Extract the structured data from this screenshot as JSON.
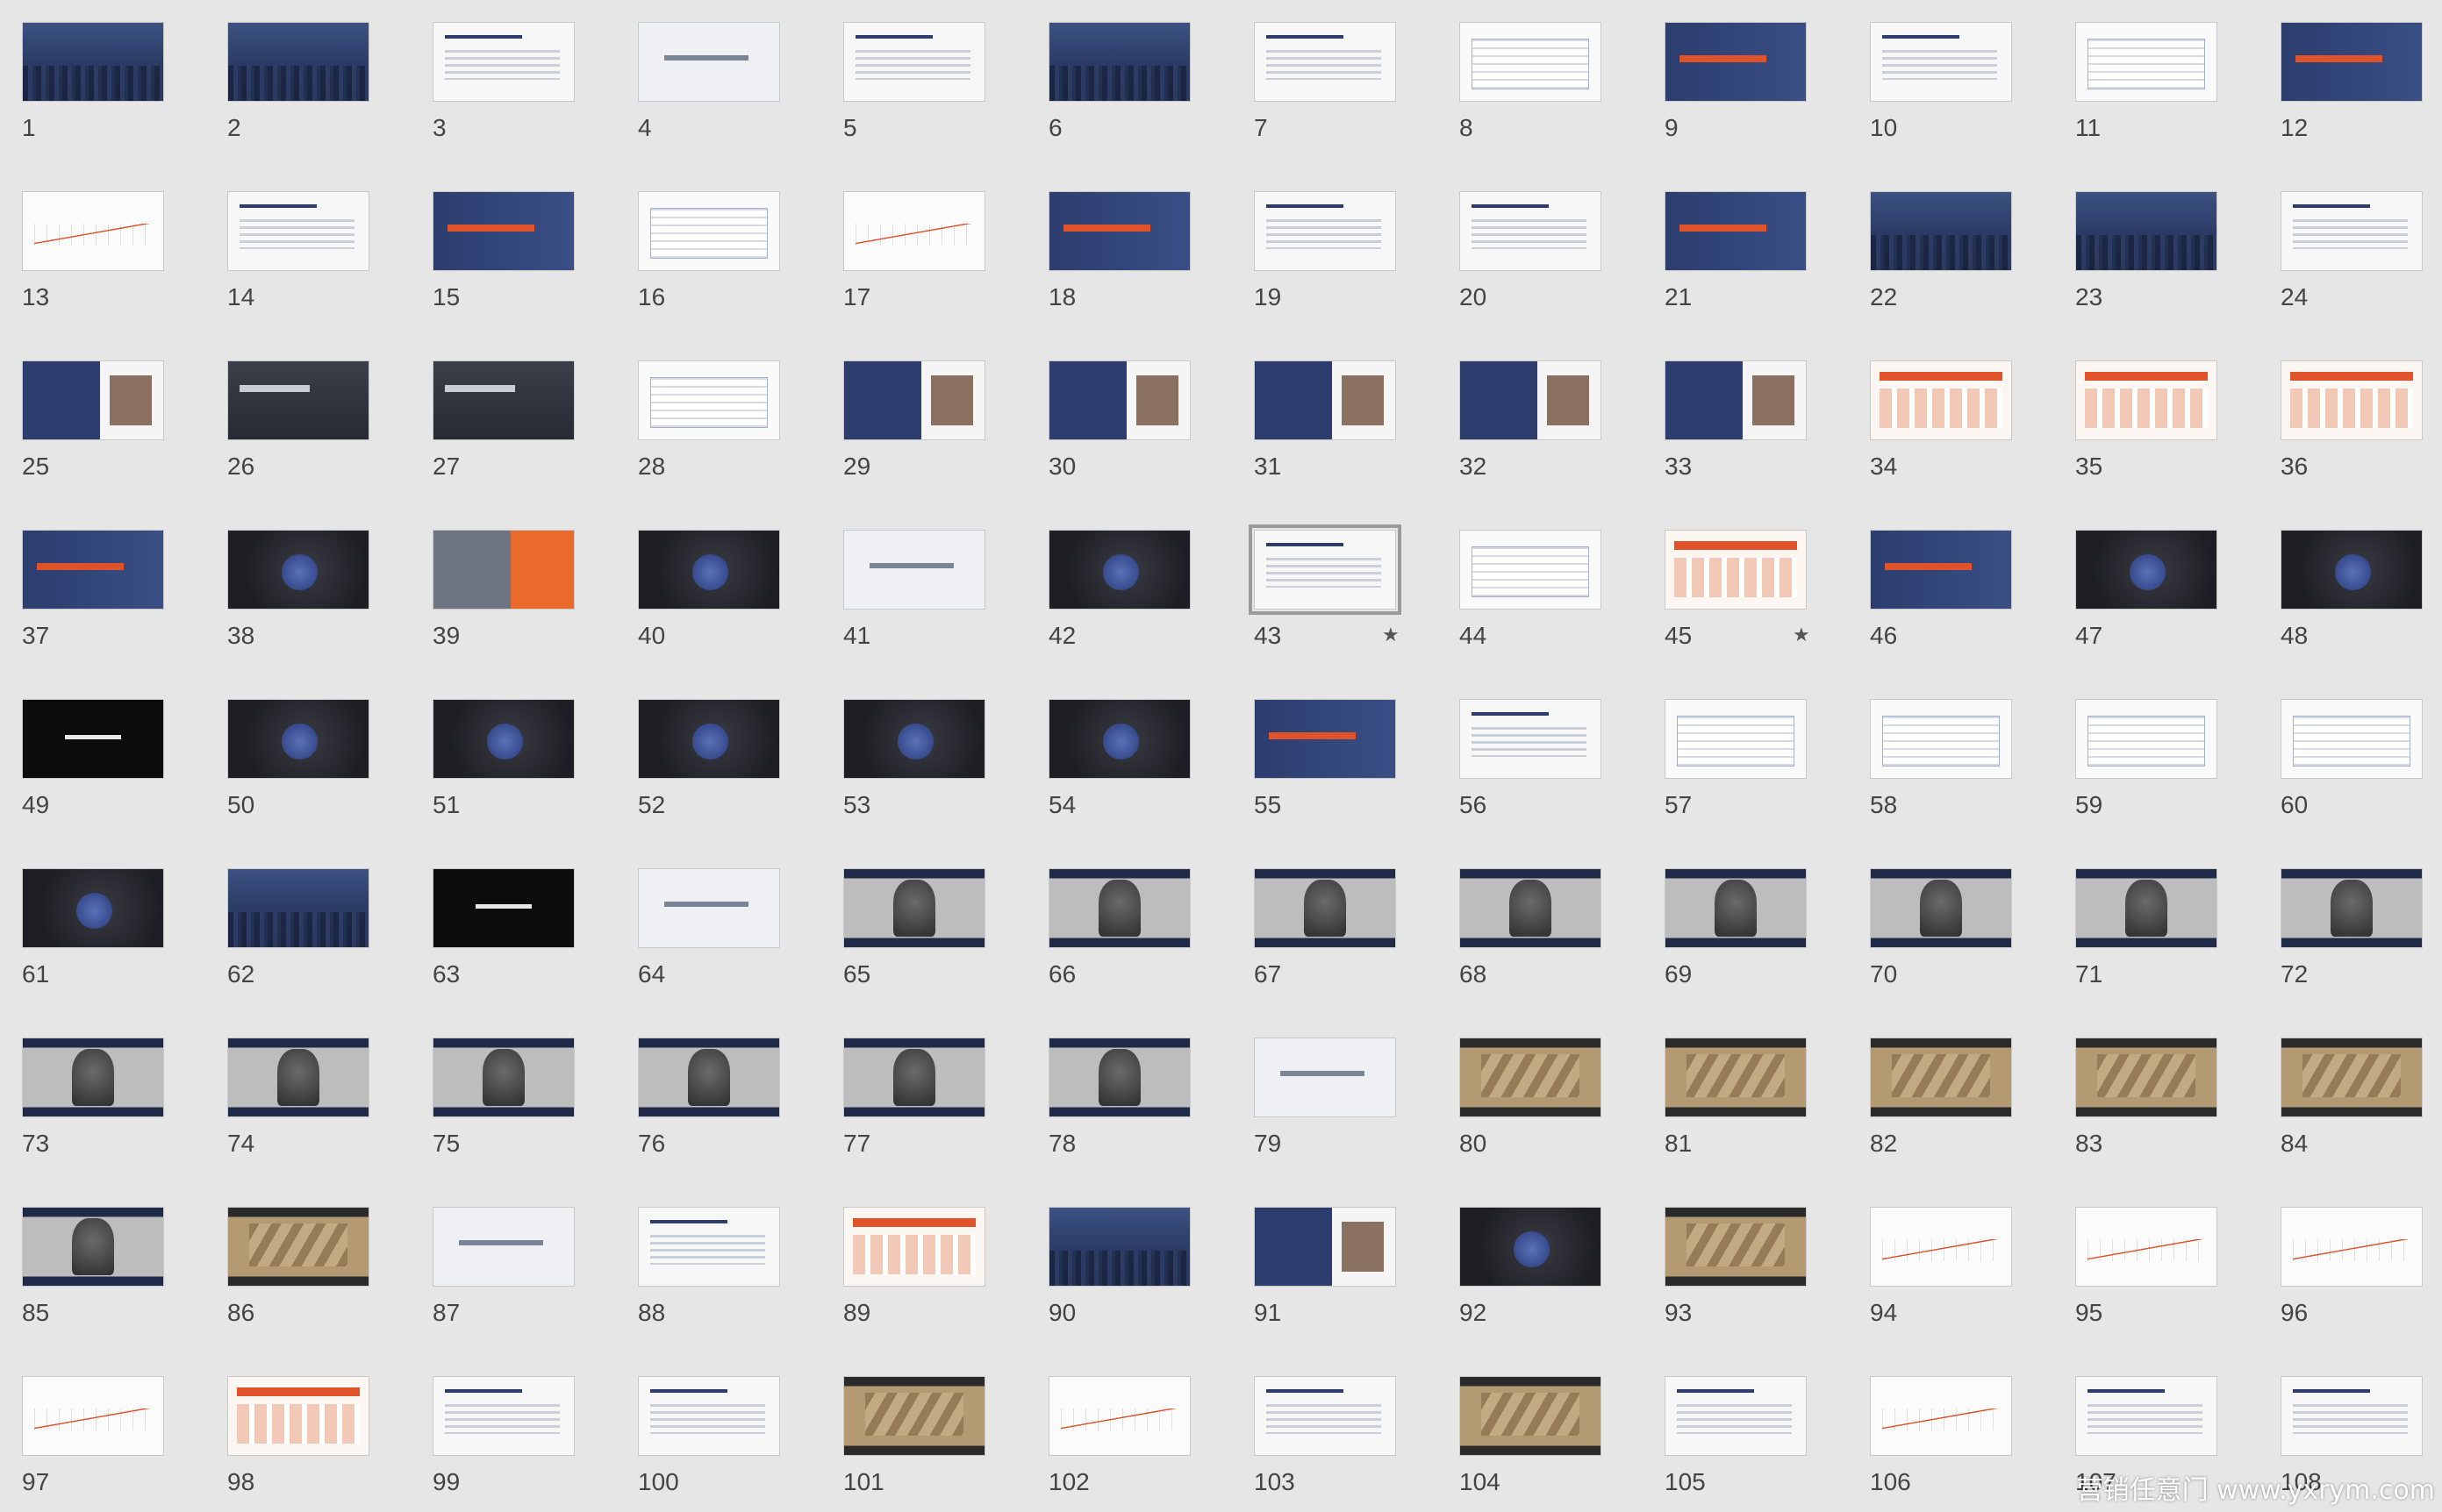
{
  "slides": [
    {
      "n": "1",
      "theme": "city"
    },
    {
      "n": "2",
      "theme": "city"
    },
    {
      "n": "3",
      "theme": "white"
    },
    {
      "n": "4",
      "theme": "light"
    },
    {
      "n": "5",
      "theme": "white"
    },
    {
      "n": "6",
      "theme": "city"
    },
    {
      "n": "7",
      "theme": "white"
    },
    {
      "n": "8",
      "theme": "table"
    },
    {
      "n": "9",
      "theme": "navy"
    },
    {
      "n": "10",
      "theme": "white"
    },
    {
      "n": "11",
      "theme": "table"
    },
    {
      "n": "12",
      "theme": "navy"
    },
    {
      "n": "13",
      "theme": "chart"
    },
    {
      "n": "14",
      "theme": "white"
    },
    {
      "n": "15",
      "theme": "navy"
    },
    {
      "n": "16",
      "theme": "table"
    },
    {
      "n": "17",
      "theme": "chart"
    },
    {
      "n": "18",
      "theme": "navy"
    },
    {
      "n": "19",
      "theme": "white"
    },
    {
      "n": "20",
      "theme": "white"
    },
    {
      "n": "21",
      "theme": "navy"
    },
    {
      "n": "22",
      "theme": "city"
    },
    {
      "n": "23",
      "theme": "city"
    },
    {
      "n": "24",
      "theme": "white"
    },
    {
      "n": "25",
      "theme": "split"
    },
    {
      "n": "26",
      "theme": "grey"
    },
    {
      "n": "27",
      "theme": "grey"
    },
    {
      "n": "28",
      "theme": "table"
    },
    {
      "n": "29",
      "theme": "split"
    },
    {
      "n": "30",
      "theme": "split"
    },
    {
      "n": "31",
      "theme": "split"
    },
    {
      "n": "32",
      "theme": "split"
    },
    {
      "n": "33",
      "theme": "split"
    },
    {
      "n": "34",
      "theme": "orange"
    },
    {
      "n": "35",
      "theme": "orange"
    },
    {
      "n": "36",
      "theme": "orange"
    },
    {
      "n": "37",
      "theme": "navy"
    },
    {
      "n": "38",
      "theme": "dark"
    },
    {
      "n": "39",
      "theme": "orangebig"
    },
    {
      "n": "40",
      "theme": "dark"
    },
    {
      "n": "41",
      "theme": "light"
    },
    {
      "n": "42",
      "theme": "dark"
    },
    {
      "n": "43",
      "theme": "white",
      "selected": true,
      "star": true
    },
    {
      "n": "44",
      "theme": "table"
    },
    {
      "n": "45",
      "theme": "orange",
      "star": true
    },
    {
      "n": "46",
      "theme": "navy"
    },
    {
      "n": "47",
      "theme": "dark"
    },
    {
      "n": "48",
      "theme": "dark"
    },
    {
      "n": "49",
      "theme": "black"
    },
    {
      "n": "50",
      "theme": "dark"
    },
    {
      "n": "51",
      "theme": "dark"
    },
    {
      "n": "52",
      "theme": "dark"
    },
    {
      "n": "53",
      "theme": "dark"
    },
    {
      "n": "54",
      "theme": "dark"
    },
    {
      "n": "55",
      "theme": "navy"
    },
    {
      "n": "56",
      "theme": "white"
    },
    {
      "n": "57",
      "theme": "table"
    },
    {
      "n": "58",
      "theme": "table"
    },
    {
      "n": "59",
      "theme": "table"
    },
    {
      "n": "60",
      "theme": "table"
    },
    {
      "n": "61",
      "theme": "dark"
    },
    {
      "n": "62",
      "theme": "city"
    },
    {
      "n": "63",
      "theme": "black"
    },
    {
      "n": "64",
      "theme": "light"
    },
    {
      "n": "65",
      "theme": "photo"
    },
    {
      "n": "66",
      "theme": "photo"
    },
    {
      "n": "67",
      "theme": "photo"
    },
    {
      "n": "68",
      "theme": "photo"
    },
    {
      "n": "69",
      "theme": "photo"
    },
    {
      "n": "70",
      "theme": "photo"
    },
    {
      "n": "71",
      "theme": "photo"
    },
    {
      "n": "72",
      "theme": "photo"
    },
    {
      "n": "73",
      "theme": "photo"
    },
    {
      "n": "74",
      "theme": "photo"
    },
    {
      "n": "75",
      "theme": "photo"
    },
    {
      "n": "76",
      "theme": "photo"
    },
    {
      "n": "77",
      "theme": "photo"
    },
    {
      "n": "78",
      "theme": "photo"
    },
    {
      "n": "79",
      "theme": "light"
    },
    {
      "n": "80",
      "theme": "sepia"
    },
    {
      "n": "81",
      "theme": "sepia"
    },
    {
      "n": "82",
      "theme": "sepia"
    },
    {
      "n": "83",
      "theme": "sepia"
    },
    {
      "n": "84",
      "theme": "sepia"
    },
    {
      "n": "85",
      "theme": "photo"
    },
    {
      "n": "86",
      "theme": "sepia"
    },
    {
      "n": "87",
      "theme": "light"
    },
    {
      "n": "88",
      "theme": "white"
    },
    {
      "n": "89",
      "theme": "orange"
    },
    {
      "n": "90",
      "theme": "city"
    },
    {
      "n": "91",
      "theme": "split"
    },
    {
      "n": "92",
      "theme": "dark"
    },
    {
      "n": "93",
      "theme": "sepia"
    },
    {
      "n": "94",
      "theme": "chart"
    },
    {
      "n": "95",
      "theme": "chart"
    },
    {
      "n": "96",
      "theme": "chart"
    },
    {
      "n": "97",
      "theme": "chart"
    },
    {
      "n": "98",
      "theme": "orange"
    },
    {
      "n": "99",
      "theme": "white"
    },
    {
      "n": "100",
      "theme": "white"
    },
    {
      "n": "101",
      "theme": "sepia"
    },
    {
      "n": "102",
      "theme": "chart"
    },
    {
      "n": "103",
      "theme": "white"
    },
    {
      "n": "104",
      "theme": "sepia"
    },
    {
      "n": "105",
      "theme": "white"
    },
    {
      "n": "106",
      "theme": "chart"
    },
    {
      "n": "107",
      "theme": "white"
    },
    {
      "n": "108",
      "theme": "white"
    }
  ],
  "star_symbol": "★",
  "watermark": "营销任意门 www.yxrym.com"
}
